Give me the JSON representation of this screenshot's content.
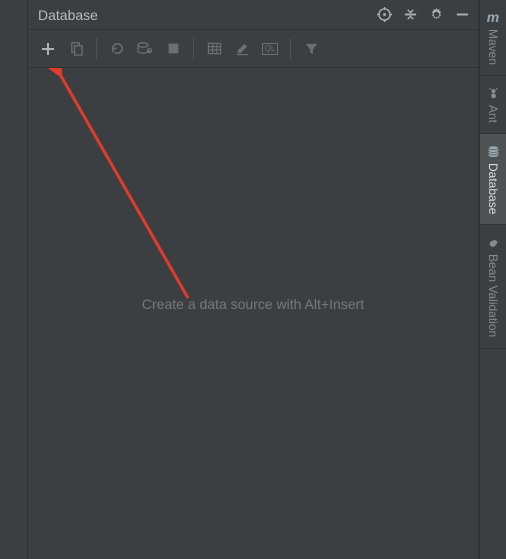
{
  "panel": {
    "title": "Database",
    "empty_hint": "Create a data source with Alt+Insert"
  },
  "toolbar": {
    "add": "Add",
    "duplicate": "Duplicate",
    "refresh": "Refresh",
    "properties": "Data Source Properties",
    "stop": "Stop",
    "table": "Table",
    "edit": "Edit",
    "ql": "QL",
    "filter": "Filter"
  },
  "header_actions": {
    "target": "Scroll from Editor",
    "collapse": "Collapse All",
    "settings": "Settings",
    "hide": "Hide"
  },
  "rail": {
    "maven": {
      "label": "Maven"
    },
    "ant": {
      "label": "Ant"
    },
    "database": {
      "label": "Database"
    },
    "bean_validation": {
      "label": "Bean Validation"
    }
  }
}
